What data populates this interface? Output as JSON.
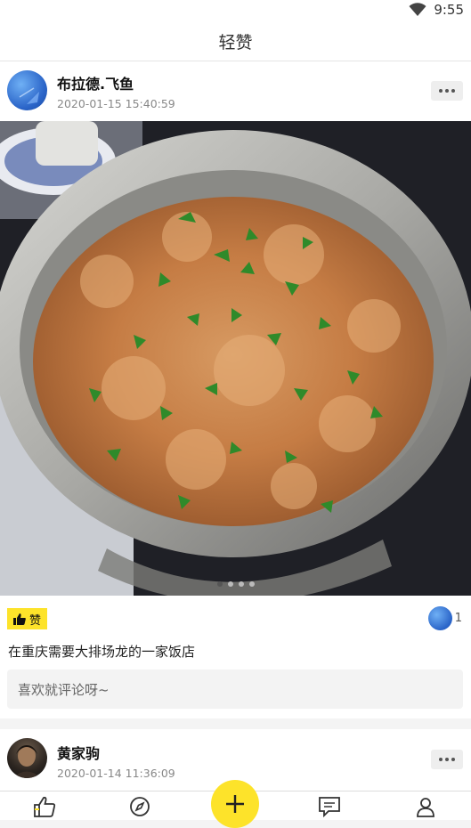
{
  "status": {
    "time": "9:55"
  },
  "appbar": {
    "title": "轻赞"
  },
  "posts": [
    {
      "username": "布拉德.飞鱼",
      "timestamp": "2020-01-15 15:40:59",
      "more": "•••",
      "like_label": "赞",
      "like_count": "1",
      "caption": "在重庆需要大排场龙的一家饭店",
      "comment_placeholder": "喜欢就评论呀~",
      "carousel": {
        "count": 4,
        "active": 1
      }
    },
    {
      "username": "黄家驹",
      "timestamp": "2020-01-14 11:36:09",
      "more": "•••"
    }
  ],
  "tabbar": {
    "icons": [
      "thumbs-up-icon",
      "compass-icon",
      "add-icon",
      "message-icon",
      "user-icon"
    ]
  },
  "colors": {
    "accent": "#fde32a",
    "text": "#222222",
    "muted": "#888888"
  }
}
